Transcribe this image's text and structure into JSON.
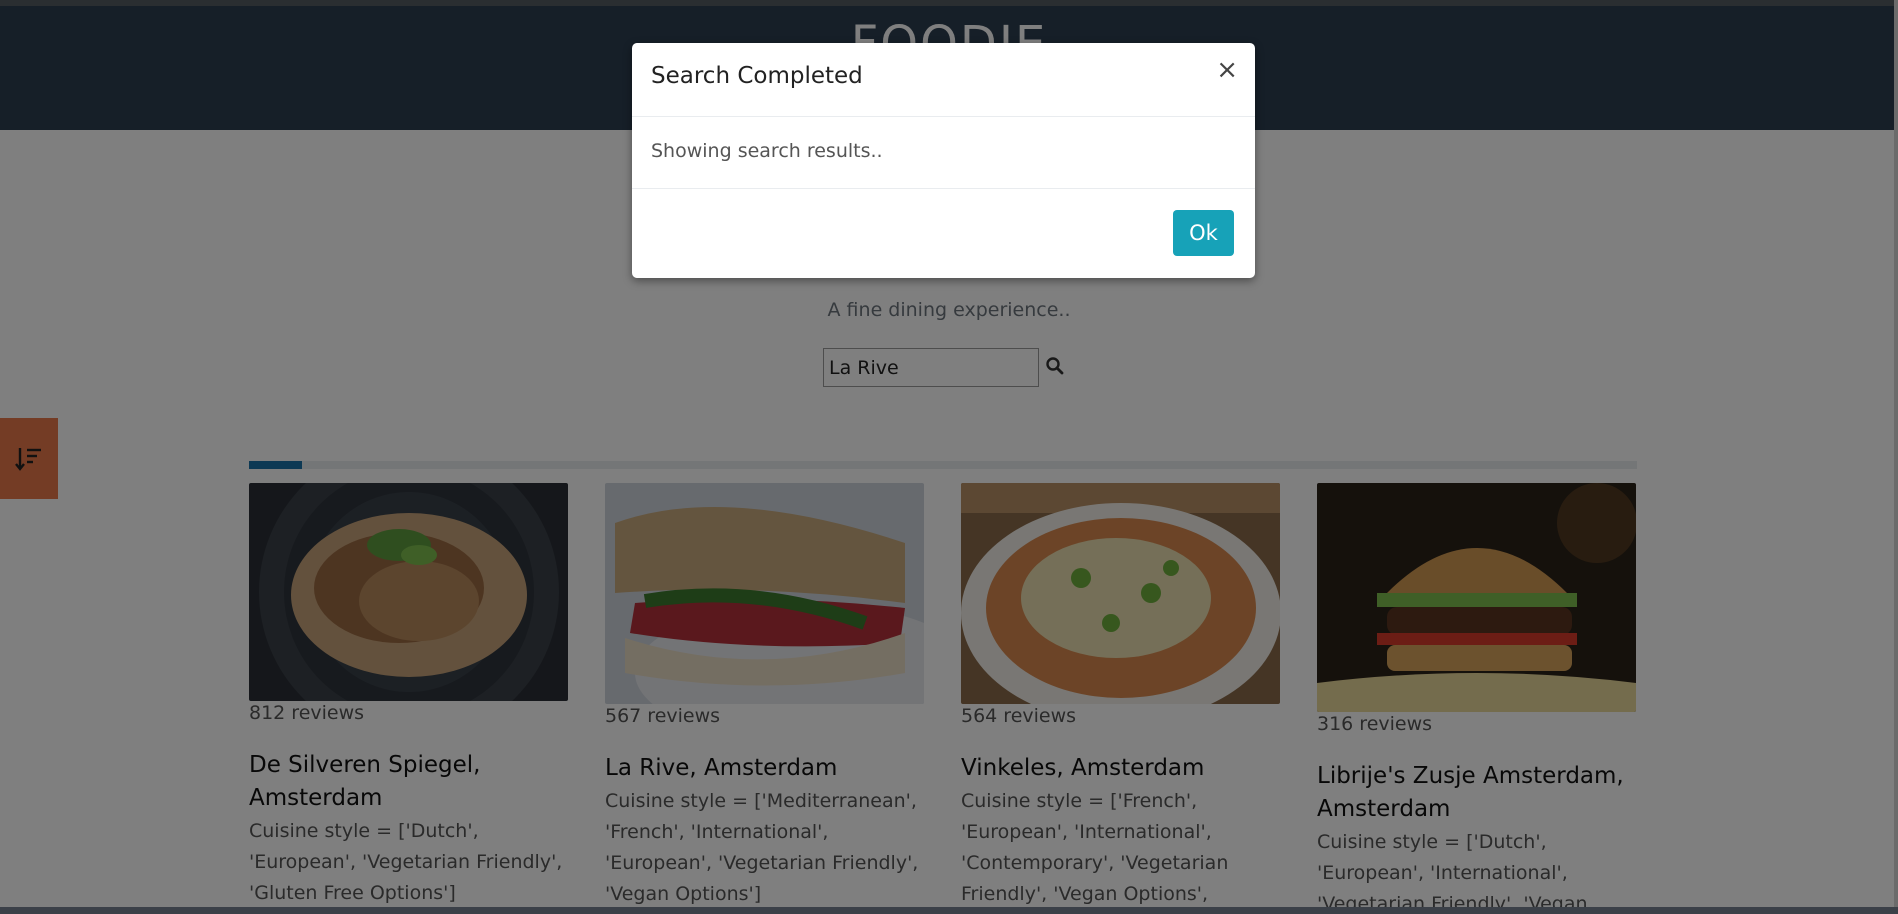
{
  "header": {
    "brand": "FOODIE"
  },
  "hero": {
    "tagline": "A fine dining experience.."
  },
  "search": {
    "value": "La Rive",
    "icon": "search-icon"
  },
  "filter": {
    "icon": "sort-icon"
  },
  "progress": {
    "fraction": 0.038
  },
  "cards": [
    {
      "reviews": "812 reviews",
      "title": "De Silveren Spiegel, Amsterdam",
      "cuisine": "Cuisine style = ['Dutch', 'European', 'Vegetarian Friendly', 'Gluten Free Options']",
      "image": "fried rice dish"
    },
    {
      "reviews": "567 reviews",
      "title": "La Rive, Amsterdam",
      "cuisine": "Cuisine style = ['Mediterranean', 'French', 'International', 'European', 'Vegetarian Friendly', 'Vegan Options']",
      "image": "ciabatta sandwich"
    },
    {
      "reviews": "564 reviews",
      "title": "Vinkeles, Amsterdam",
      "cuisine": "Cuisine style = ['French', 'European', 'International', 'Contemporary', 'Vegetarian Friendly', 'Vegan Options', 'Gluten",
      "image": "noodle bowl"
    },
    {
      "reviews": "316 reviews",
      "title": "Librije's Zusje Amsterdam, Amsterdam",
      "cuisine": "Cuisine style = ['Dutch', 'European', 'International', 'Vegetarian Friendly', 'Vegan",
      "image": "burger"
    }
  ],
  "modal": {
    "title": "Search Completed",
    "close": "×",
    "body": "Showing search results..",
    "ok_label": "Ok"
  },
  "colors": {
    "header": "#2c3e50",
    "accent": "#17a2b8",
    "filter_tab": "#e8784a",
    "progress": "#1a73a8"
  }
}
